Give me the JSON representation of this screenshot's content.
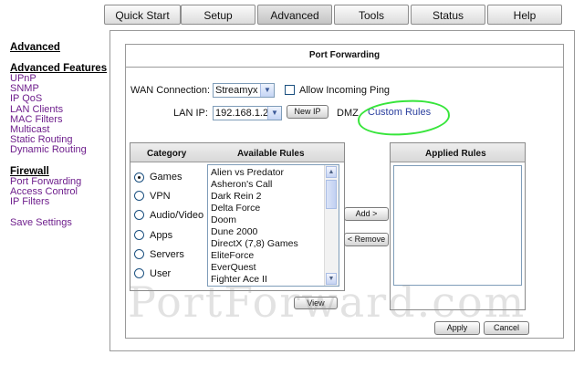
{
  "tabs": [
    {
      "label": "Quick Start",
      "active": false
    },
    {
      "label": "Setup",
      "active": false
    },
    {
      "label": "Advanced",
      "active": true
    },
    {
      "label": "Tools",
      "active": false
    },
    {
      "label": "Status",
      "active": false
    },
    {
      "label": "Help",
      "active": false
    }
  ],
  "sidebar": {
    "section_advanced": "Advanced",
    "section_features": "Advanced Features",
    "features": [
      "UPnP",
      "SNMP",
      "IP QoS",
      "LAN Clients",
      "MAC Filters",
      "Multicast",
      "Static Routing",
      "Dynamic Routing"
    ],
    "section_firewall": "Firewall",
    "firewall": [
      "Port Forwarding",
      "Access Control",
      "IP Filters"
    ],
    "save_settings": "Save Settings"
  },
  "panel": {
    "title": "Port Forwarding",
    "wan_label": "WAN Connection:",
    "wan_value": "Streamyx",
    "allow_ping_label": "Allow Incoming Ping",
    "lan_label": "LAN IP:",
    "lan_value": "192.168.1.2",
    "new_ip_button": "New IP",
    "dmz_label": "DMZ",
    "custom_rules_link": "Custom Rules",
    "category_header": "Category",
    "available_header": "Available Rules",
    "applied_header": "Applied Rules",
    "categories": [
      "Games",
      "VPN",
      "Audio/Video",
      "Apps",
      "Servers",
      "User"
    ],
    "selected_category": "Games",
    "available_rules": [
      "Alien vs Predator",
      "Asheron's Call",
      "Dark Rein 2",
      "Delta Force",
      "Doom",
      "Dune 2000",
      "DirectX (7,8) Games",
      "EliteForce",
      "EverQuest",
      "Fighter Ace II"
    ],
    "add_button": "Add >",
    "remove_button": "< Remove",
    "view_button": "View",
    "apply_button": "Apply",
    "cancel_button": "Cancel"
  },
  "watermark": "PortForward.com",
  "icons": {
    "dropdown": "chevron-down-icon",
    "scroll_up": "arrow-up-icon",
    "scroll_down": "arrow-down-icon"
  },
  "colors": {
    "link": "#6e1e8c",
    "custom_rules_link": "#2b3f9e",
    "highlight_circle": "#37e53b"
  }
}
